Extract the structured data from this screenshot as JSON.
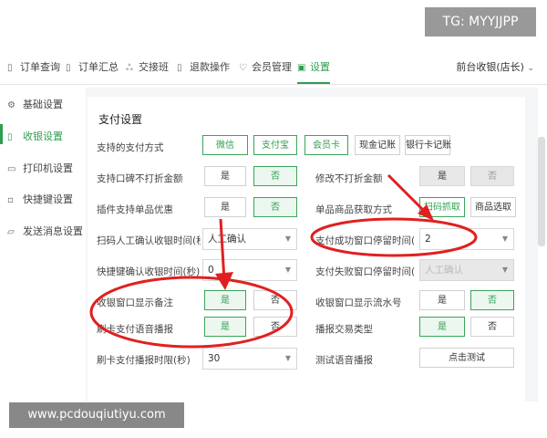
{
  "watermark_top": "TG: MYYJJPP",
  "watermark_bottom": "www.pcdouqiutiyu.com",
  "nav": {
    "items": [
      {
        "label": "订单查询",
        "icon": "doc-icon"
      },
      {
        "label": "订单汇总",
        "icon": "doc-icon"
      },
      {
        "label": "交接班",
        "icon": "handover-icon"
      },
      {
        "label": "退款操作",
        "icon": "refund-icon"
      },
      {
        "label": "会员管理",
        "icon": "member-icon"
      },
      {
        "label": "设置",
        "icon": "settings-icon"
      }
    ],
    "active": "设置",
    "user": "前台收银(店长)"
  },
  "sidebar": {
    "items": [
      {
        "label": "基础设置"
      },
      {
        "label": "收银设置"
      },
      {
        "label": "打印机设置"
      },
      {
        "label": "快捷键设置"
      },
      {
        "label": "发送消息设置"
      }
    ],
    "active": "收银设置"
  },
  "section_title": "支付设置",
  "rows": {
    "pay_methods_label": "支持的支付方式",
    "pay_methods": [
      "微信",
      "支付宝",
      "会员卡",
      "现金记账",
      "银行卡记账"
    ],
    "no_print_amount_label": "支持口碑不打折金额",
    "yes": "是",
    "no": "否",
    "modify_no_discount_label": "修改不打折金额",
    "plugin_discount_label": "插件支持单品优惠",
    "single_item_label": "单品商品获取方式",
    "single_item_opts": [
      "扫码抓取",
      "商品选取"
    ],
    "scan_confirm_label": "扫码人工确认收银时间(秒)",
    "scan_confirm_value": "人工确认",
    "success_stay_label": "支付成功窗口停留时间(秒)",
    "success_stay_value": "2",
    "shortcut_confirm_label": "快捷键确认收银时间(秒)",
    "shortcut_confirm_value": "0",
    "fail_stay_label": "支付失败窗口停留时间(秒)",
    "fail_stay_value": "人工确认",
    "show_remark_label": "收银窗口显示备注",
    "show_serial_label": "收银窗口显示流水号",
    "card_voice_label": "刷卡支付语音播报",
    "trade_type_label": "播报交易类型",
    "card_timeout_label": "刷卡支付播报时限(秒)",
    "card_timeout_value": "30",
    "test_voice_label": "测试语音播报",
    "test_button": "点击测试"
  },
  "colors": {
    "accent": "#2e9e4f",
    "annotation": "#e02020"
  }
}
